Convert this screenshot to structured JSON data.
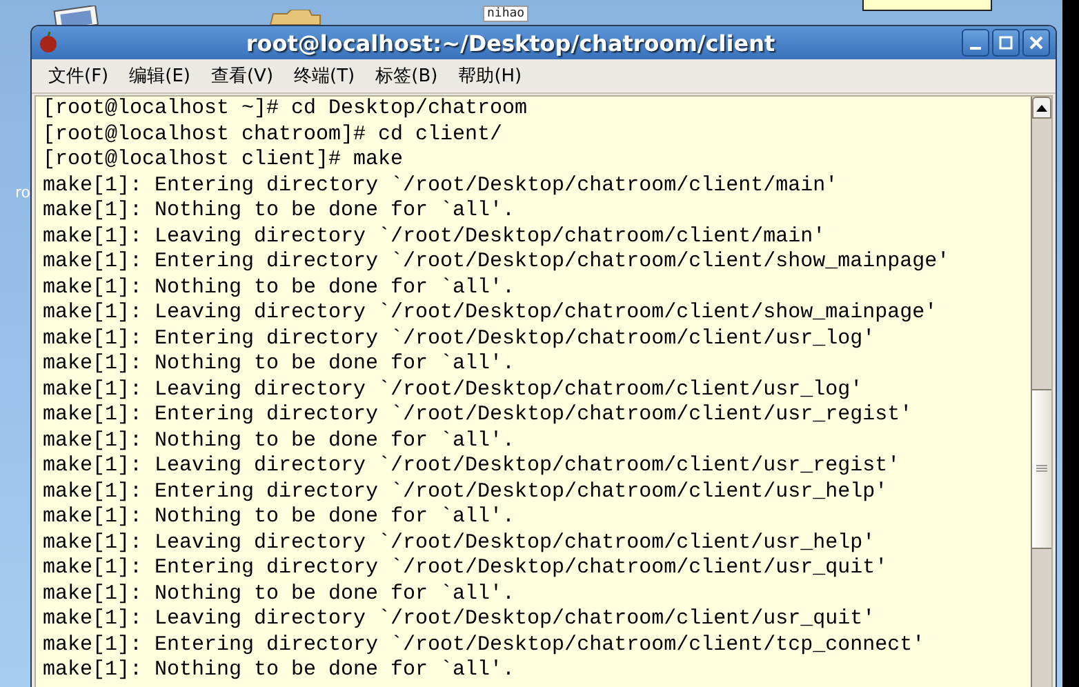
{
  "desktop": {
    "icons": [
      {
        "kind": "computer"
      },
      {
        "kind": "folder"
      },
      {
        "kind": "file",
        "label": "nihao"
      },
      {
        "kind": "note"
      },
      {
        "kind": "hidden",
        "label": "ro"
      }
    ]
  },
  "window": {
    "title": "root@localhost:~/Desktop/chatroom/client"
  },
  "menu": [
    "文件(F)",
    "编辑(E)",
    "查看(V)",
    "终端(T)",
    "标签(B)",
    "帮助(H)"
  ],
  "terminal": {
    "lines": [
      "[root@localhost ~]# cd Desktop/chatroom",
      "[root@localhost chatroom]# cd client/",
      "[root@localhost client]# make",
      "make[1]: Entering directory `/root/Desktop/chatroom/client/main'",
      "make[1]: Nothing to be done for `all'.",
      "make[1]: Leaving directory `/root/Desktop/chatroom/client/main'",
      "make[1]: Entering directory `/root/Desktop/chatroom/client/show_mainpage'",
      "make[1]: Nothing to be done for `all'.",
      "make[1]: Leaving directory `/root/Desktop/chatroom/client/show_mainpage'",
      "make[1]: Entering directory `/root/Desktop/chatroom/client/usr_log'",
      "make[1]: Nothing to be done for `all'.",
      "make[1]: Leaving directory `/root/Desktop/chatroom/client/usr_log'",
      "make[1]: Entering directory `/root/Desktop/chatroom/client/usr_regist'",
      "make[1]: Nothing to be done for `all'.",
      "make[1]: Leaving directory `/root/Desktop/chatroom/client/usr_regist'",
      "make[1]: Entering directory `/root/Desktop/chatroom/client/usr_help'",
      "make[1]: Nothing to be done for `all'.",
      "make[1]: Leaving directory `/root/Desktop/chatroom/client/usr_help'",
      "make[1]: Entering directory `/root/Desktop/chatroom/client/usr_quit'",
      "make[1]: Nothing to be done for `all'.",
      "make[1]: Leaving directory `/root/Desktop/chatroom/client/usr_quit'",
      "make[1]: Entering directory `/root/Desktop/chatroom/client/tcp_connect'",
      "make[1]: Nothing to be done for `all'."
    ]
  }
}
